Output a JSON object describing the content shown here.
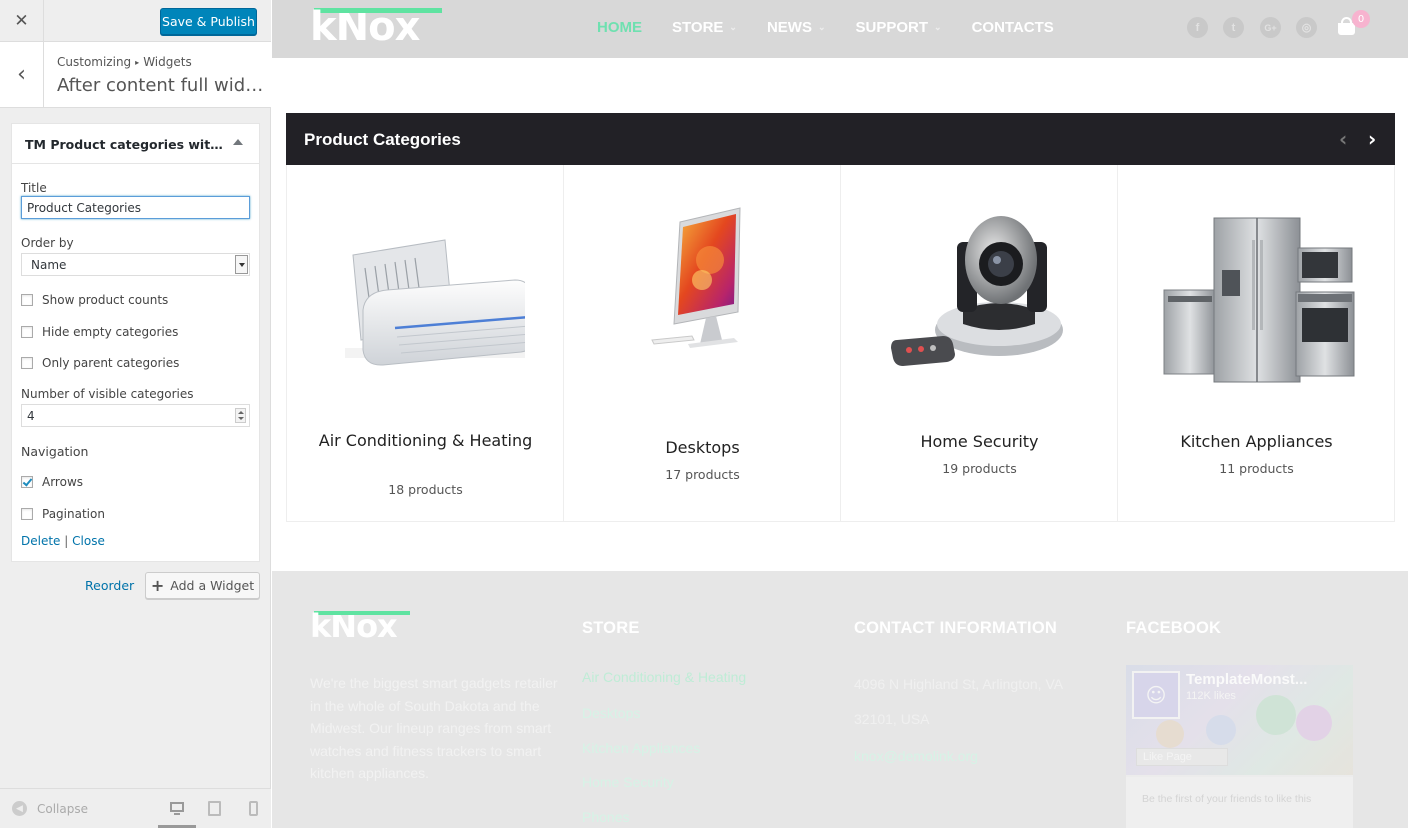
{
  "sidebar": {
    "close_glyph": "✕",
    "save_label": "Save & Publish",
    "back_glyph": "‹",
    "breadcrumb": {
      "root": "Customizing",
      "separator": "▸",
      "section": "Widgets"
    },
    "panel_title": "After content full width wi...",
    "widget": {
      "name": "TM Product categories with thu...",
      "title_label": "Title",
      "title_value": "Product Categories",
      "order_label": "Order by",
      "order_value": "Name",
      "options": [
        {
          "label": "Show product counts",
          "checked": false
        },
        {
          "label": "Hide empty categories",
          "checked": false
        },
        {
          "label": "Only parent categories",
          "checked": false
        }
      ],
      "visible_label": "Number of visible categories",
      "visible_value": "4",
      "navigation_label": "Navigation",
      "nav_options": [
        {
          "label": "Arrows",
          "checked": true
        },
        {
          "label": "Pagination",
          "checked": false
        }
      ],
      "delete_label": "Delete",
      "links_separator": "|",
      "close_label": "Close"
    },
    "reorder_label": "Reorder",
    "add_widget_plus": "+",
    "add_widget_label": "Add a Widget",
    "collapse_glyph": "◀",
    "collapse_label": "Collapse",
    "devices": [
      "desktop-icon",
      "tablet-icon",
      "mobile-icon"
    ]
  },
  "site": {
    "logo": {
      "k": "k",
      "rest": "Nox"
    },
    "nav": [
      {
        "label": "HOME",
        "active": true,
        "has_dropdown": false
      },
      {
        "label": "STORE",
        "active": false,
        "has_dropdown": true
      },
      {
        "label": "NEWS",
        "active": false,
        "has_dropdown": true
      },
      {
        "label": "SUPPORT",
        "active": false,
        "has_dropdown": true
      },
      {
        "label": "CONTACTS",
        "active": false,
        "has_dropdown": false
      }
    ],
    "dropdown_glyph": "⌄",
    "social": [
      {
        "name": "facebook-icon",
        "glyph": "f"
      },
      {
        "name": "twitter-icon",
        "glyph": "t"
      },
      {
        "name": "google-plus-icon",
        "glyph": "G+"
      },
      {
        "name": "instagram-icon",
        "glyph": "◎"
      }
    ],
    "cart_count": "0",
    "categories_widget": {
      "title": "Product Categories",
      "prev_glyph": "‹",
      "next_glyph": "›",
      "items": [
        {
          "name": "Air Conditioning & Heating",
          "count": "18 products",
          "icon": "air-conditioner-image"
        },
        {
          "name": "Desktops",
          "count": "17 products",
          "icon": "desktop-computer-image"
        },
        {
          "name": "Home Security",
          "count": "19 products",
          "icon": "security-camera-image"
        },
        {
          "name": "Kitchen Appliances",
          "count": "11 products",
          "icon": "kitchen-appliances-image"
        }
      ]
    },
    "footer": {
      "about": "We're the biggest smart gadgets retailer in the whole of South Dakota and the Midwest. Our lineup ranges from smart watches and fitness trackers to smart kitchen appliances.",
      "store_heading": "STORE",
      "store_links": [
        "Air Conditioning & Heating",
        "Desktops",
        "Kitchen Appliances",
        "Home Security",
        "Phones"
      ],
      "contact_heading": "CONTACT INFORMATION",
      "contact_lines": [
        "4096 N Highland St, Arlington, VA",
        "32101, USA"
      ],
      "contact_email": "knox@demolink.org",
      "facebook_heading": "FACEBOOK",
      "facebook": {
        "page_name": "TemplateMonst...",
        "likes": "112K likes",
        "like_button": "Like Page",
        "friends_text": "Be the first of your friends to like this"
      }
    }
  },
  "colors": {
    "accent_green": "#5fe3a1",
    "wp_blue": "#0085ba",
    "link_blue": "#0073aa",
    "category_header_bg": "#222126",
    "cart_badge": "#f7b3cf"
  }
}
